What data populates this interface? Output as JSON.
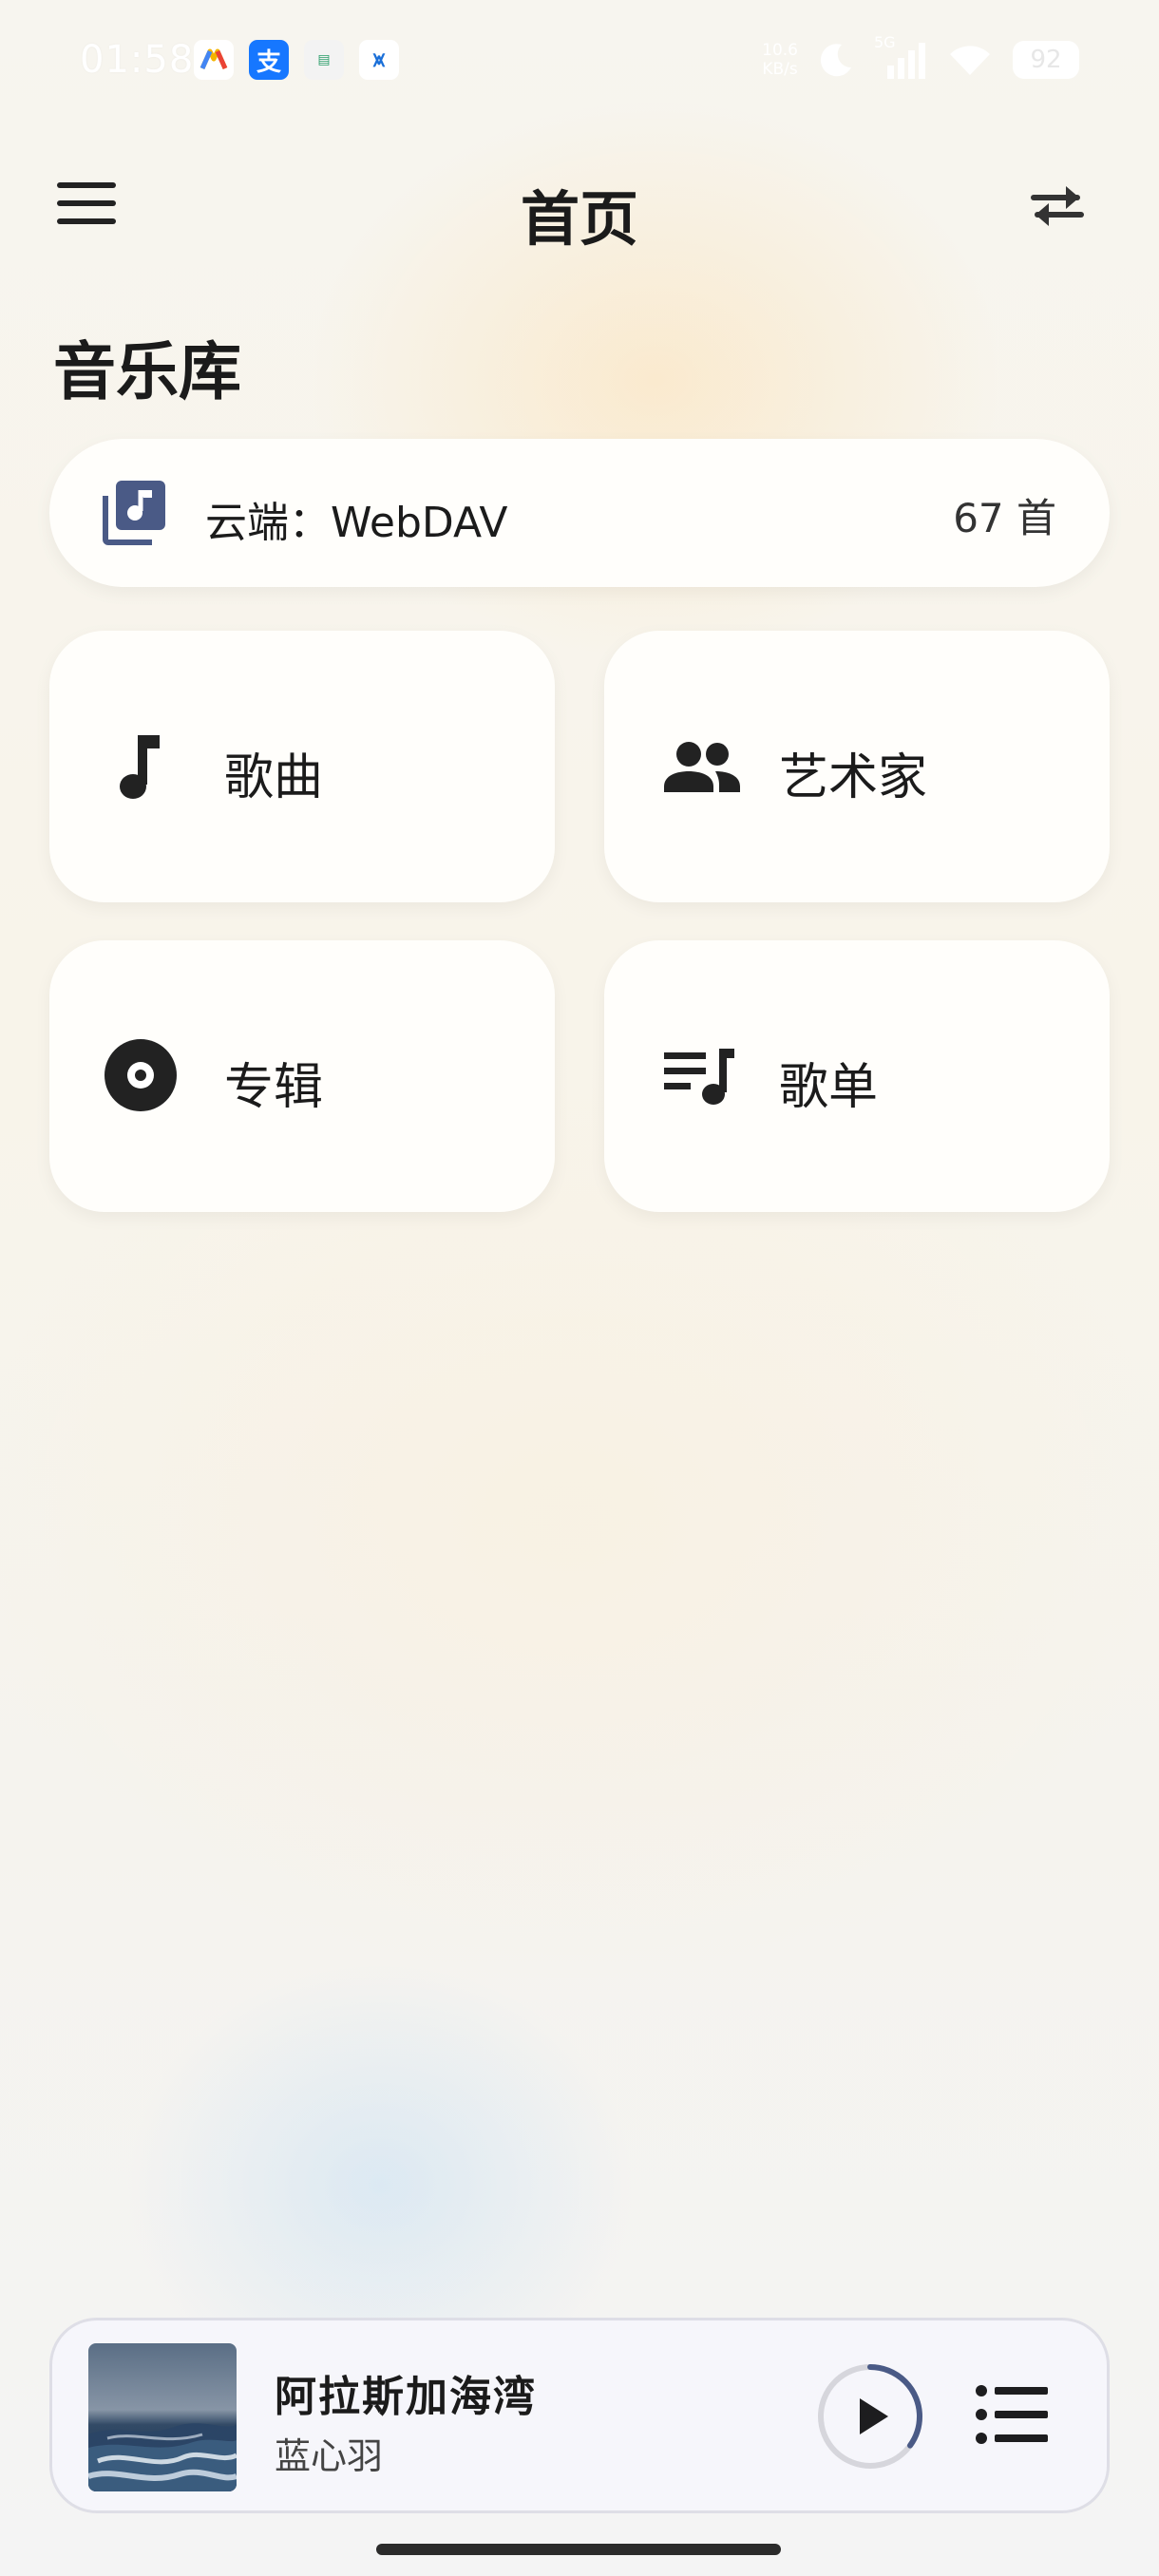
{
  "status_bar": {
    "time": "01:58",
    "net_speed_value": "10.6",
    "net_speed_unit": "KB/s",
    "network": "5G",
    "battery": "92"
  },
  "header": {
    "title": "首页"
  },
  "library": {
    "section_title": "音乐库",
    "source_label": "云端：WebDAV",
    "source_count": "67 首",
    "tiles": [
      {
        "label": "歌曲",
        "icon": "music-note-icon"
      },
      {
        "label": "艺术家",
        "icon": "people-icon"
      },
      {
        "label": "专辑",
        "icon": "album-disc-icon"
      },
      {
        "label": "歌单",
        "icon": "playlist-icon"
      }
    ]
  },
  "player": {
    "title": "阿拉斯加海湾",
    "artist": "蓝心羽",
    "progress": 0.35
  },
  "colors": {
    "accent": "#4a5a86",
    "icon_dark": "#222222"
  }
}
